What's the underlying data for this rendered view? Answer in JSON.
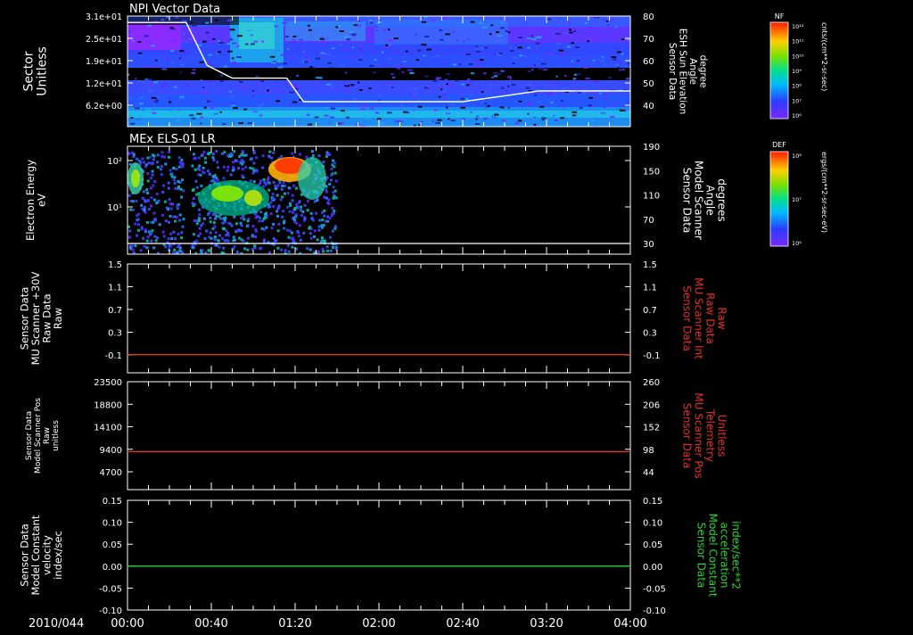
{
  "date_label": "2010/044",
  "time_ticks": [
    "00:00",
    "00:40",
    "01:20",
    "02:00",
    "02:40",
    "03:20",
    "04:00"
  ],
  "time_range_minutes": [
    0,
    240
  ],
  "chart_data": [
    {
      "type": "heatmap",
      "title": "NPI Vector Data",
      "ylabel_left": [
        "Sector",
        "Unitless"
      ],
      "y_ticks_left": [
        "3.1e+01",
        "2.5e+01",
        "1.9e+01",
        "1.2e+01",
        "6.2e+00"
      ],
      "ylabel_right": [
        "Sensor Data",
        "ESH Sun Elevation",
        "Angle",
        "degree"
      ],
      "y_ticks_right": [
        "80",
        "70",
        "60",
        "50",
        "40"
      ],
      "ylim_right": [
        30,
        80
      ],
      "colorbar": {
        "label": "NF",
        "unit": "cnts/(cm**2-sr-sec)",
        "ticks": [
          "10¹²",
          "10¹¹",
          "10¹⁰",
          "10⁹",
          "10⁸",
          "10⁷",
          "10⁶"
        ]
      },
      "overlay_line": {
        "name": "ESH Sun Elevation Angle",
        "color": "#ffffff",
        "x_minutes": [
          0,
          28,
          38,
          50,
          76,
          84,
          100,
          130,
          160,
          182,
          196,
          215,
          240
        ],
        "y": [
          77,
          77,
          57,
          51,
          51,
          40,
          40,
          40,
          40,
          43,
          45,
          45,
          45
        ]
      }
    },
    {
      "type": "heatmap",
      "title": "MEx ELS-01 LR",
      "ylabel_left": [
        "Electron Energy",
        "eV"
      ],
      "y_ticks_left": [
        "10²",
        "10¹"
      ],
      "ylabel_right": [
        "Sensor Data",
        "Model Scanner",
        "Angle",
        "degrees"
      ],
      "y_ticks_right": [
        "190",
        "150",
        "110",
        "70",
        "30"
      ],
      "ylim_right": [
        10,
        190
      ],
      "colorbar": {
        "label": "DEF",
        "unit": "ergs/(cm**2-sr-sec-eV)",
        "ticks": [
          "10⁸",
          "10⁷",
          "10⁶"
        ]
      },
      "overlay_line": {
        "name": "Model Scanner Angle",
        "color": "#ffffff",
        "x_minutes": [
          0,
          240
        ],
        "y": [
          10,
          10
        ]
      }
    },
    {
      "type": "line",
      "ylabel_left": [
        "Sensor Data",
        "MU Scanner +30V",
        "Raw Data",
        "Raw"
      ],
      "y_ticks_left": [
        "1.5",
        "1.1",
        "0.7",
        "0.3",
        "-0.1"
      ],
      "ylim": [
        -0.3,
        1.5
      ],
      "ylabel_right": [
        "Sensor Data",
        "MU Scanner Int",
        "Raw Data",
        "Raw"
      ],
      "y_ticks_right": [
        "1.5",
        "1.1",
        "0.7",
        "0.3",
        "-0.1"
      ],
      "series": [
        {
          "name": "MU Scanner Int Raw Data",
          "color": "#e0302a",
          "x_minutes": [
            0,
            240
          ],
          "y": [
            0,
            0
          ]
        }
      ]
    },
    {
      "type": "line",
      "ylabel_left": [
        "Sensor Data",
        "Model Scanner Pos",
        "Raw",
        "unitless"
      ],
      "y_ticks_left": [
        "23500",
        "18800",
        "14100",
        "9400",
        "4700"
      ],
      "ylim": [
        0,
        23500
      ],
      "ylabel_right": [
        "Sensor Data",
        "MU Scanner Pos",
        "Telemetry",
        "Unitless"
      ],
      "y_ticks_right": [
        "260",
        "206",
        "152",
        "98",
        "44"
      ],
      "ylim_right": [
        -10,
        260
      ],
      "series": [
        {
          "name": "MU Scanner Pos Telemetry",
          "color": "#e0302a",
          "x_minutes": [
            0,
            240
          ],
          "y": [
            8300,
            8300
          ]
        }
      ]
    },
    {
      "type": "line",
      "ylabel_left": [
        "Sensor Data",
        "Model Constant",
        "velocity",
        "index/sec"
      ],
      "y_ticks_left": [
        "0.15",
        "0.10",
        "0.05",
        "0.00",
        "-0.05",
        "-0.10"
      ],
      "ylim": [
        -0.1,
        0.15
      ],
      "ylabel_right": [
        "Sensor Data",
        "Model Constant",
        "acceleration",
        "index/sec**2"
      ],
      "y_ticks_right": [
        "0.15",
        "0.10",
        "0.05",
        "0.00",
        "-0.05",
        "-0.10"
      ],
      "series": [
        {
          "name": "Model Constant acceleration",
          "color": "#30d030",
          "x_minutes": [
            0,
            240
          ],
          "y": [
            0,
            0
          ]
        }
      ]
    }
  ]
}
